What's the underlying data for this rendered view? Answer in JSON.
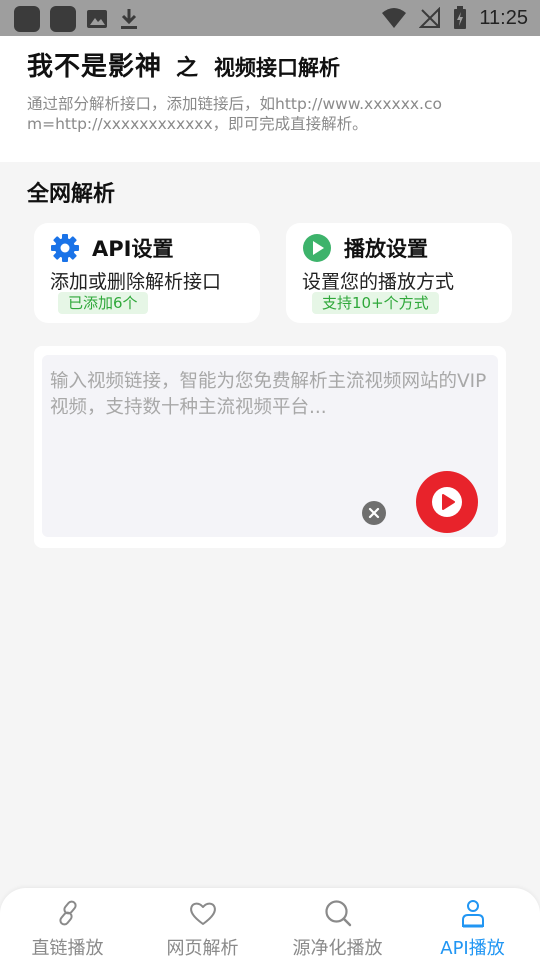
{
  "status_bar": {
    "time": "11:25"
  },
  "header": {
    "app_name": "我不是影神",
    "connector": "之",
    "subtitle": "视频接口解析",
    "description": "通过部分解析接口，添加链接后，如http://www.xxxxxx.com=http://xxxxxxxxxxxx，即可完成直接解析。"
  },
  "section_title": "全网解析",
  "cards": {
    "api": {
      "title": "API设置",
      "subtitle": "添加或删除解析接口",
      "tag": "已添加6个",
      "icon": "gear-icon",
      "icon_color": "#1a73e8"
    },
    "play": {
      "title": "播放设置",
      "subtitle": "设置您的播放方式",
      "tag": "支持10+个方式",
      "icon": "play-circle-icon",
      "icon_color": "#3db36b"
    }
  },
  "input": {
    "value": "",
    "placeholder": "输入视频链接，智能为您免费解析主流视频网站的VIP视频，支持数十种主流视频平台..."
  },
  "bottom_nav": {
    "items": [
      {
        "label": "直链播放",
        "icon": "link-icon",
        "active": false
      },
      {
        "label": "网页解析",
        "icon": "heart-icon",
        "active": false
      },
      {
        "label": "源净化播放",
        "icon": "search-icon",
        "active": false
      },
      {
        "label": "API播放",
        "icon": "person-icon",
        "active": true
      }
    ]
  },
  "colors": {
    "accent": "#2196f3",
    "play_button": "#e8232b",
    "tag_green": "#2fa83a"
  }
}
